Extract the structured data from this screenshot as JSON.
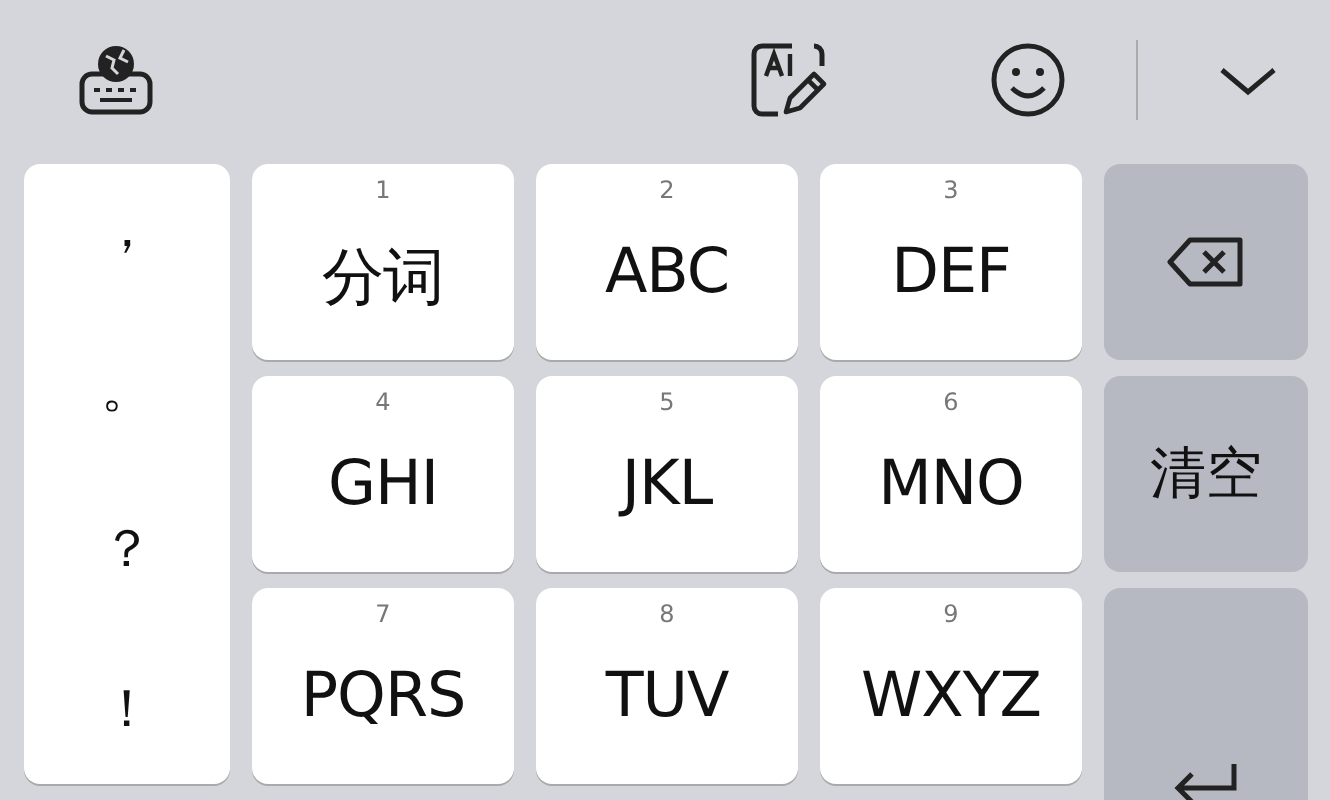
{
  "punctuation": [
    "，",
    "。",
    "？",
    "！"
  ],
  "keys": [
    {
      "number": "1",
      "label": "分词"
    },
    {
      "number": "2",
      "label": "ABC"
    },
    {
      "number": "3",
      "label": "DEF"
    },
    {
      "number": "4",
      "label": "GHI"
    },
    {
      "number": "5",
      "label": "JKL"
    },
    {
      "number": "6",
      "label": "MNO"
    },
    {
      "number": "7",
      "label": "PQRS"
    },
    {
      "number": "8",
      "label": "TUV"
    },
    {
      "number": "9",
      "label": "WXYZ"
    }
  ],
  "function_keys": [
    {
      "kind": "backspace"
    },
    {
      "kind": "text",
      "label": "清空"
    },
    {
      "kind": "enter"
    }
  ]
}
